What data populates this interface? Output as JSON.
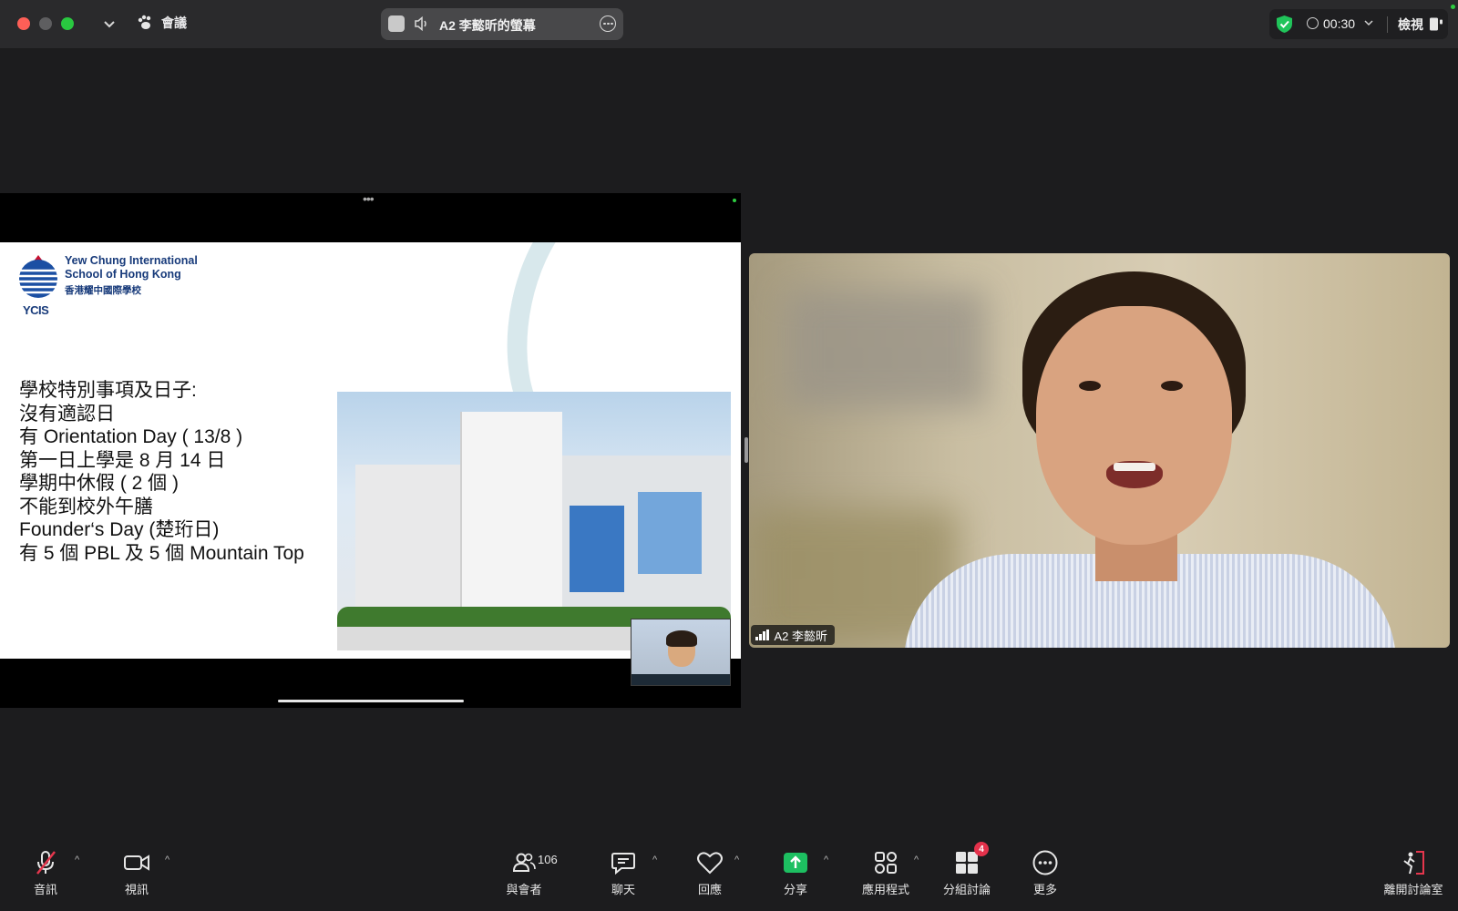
{
  "titlebar": {
    "meeting_label": "會議",
    "share_title": "A2 李懿昕的螢幕",
    "timer": "00:30",
    "view_label": "檢視"
  },
  "slide": {
    "school_name_en_line1": "Yew Chung International",
    "school_name_en_line2": "School of Hong Kong",
    "school_name_zh": "香港耀中國際學校",
    "logo_text": "YCIS",
    "lines": [
      "學校特別事項及日子:",
      "沒有適認日",
      "有 Orientation Day ( 13/8 )",
      "第一日上學是 8 月 14 日",
      "學期中休假 ( 2 個 )",
      "不能到校外午膳",
      "Founder‘s Day (楚珩日)",
      "有 5 個 PBL 及 5 個 Mountain Top"
    ]
  },
  "participant": {
    "name": "A2 李懿昕"
  },
  "toolbar": {
    "audio": "音訊",
    "video": "視訊",
    "participants": "與會者",
    "participants_count": "106",
    "chat": "聊天",
    "react": "回應",
    "share": "分享",
    "apps": "應用程式",
    "breakout": "分組討論",
    "breakout_badge": "4",
    "more": "更多",
    "leave_breakout": "離開討論室"
  },
  "colors": {
    "share_green": "#1dbf61",
    "badge_red": "#e4314b",
    "mute_red": "#e5364d"
  }
}
